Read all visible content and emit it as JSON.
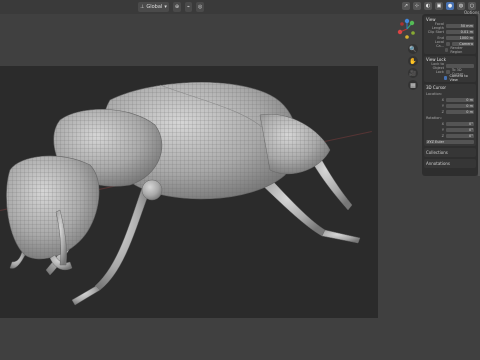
{
  "header": {
    "orientation_label": "Global",
    "options_label": "Options"
  },
  "n_panel": {
    "view_section": "View",
    "focal_label": "Focal Length",
    "focal_value": "50 mm",
    "clip_start_label": "Clip Start",
    "clip_start_value": "0.01 m",
    "clip_end_label": "End",
    "clip_end_value": "1000 m",
    "local_camera_label": "Local Ca...",
    "camera_value": "Camera",
    "render_region_label": "Render Region",
    "view_lock_section": "View Lock",
    "lock_to_object_label": "Lock to Object",
    "lock_label": "Lock",
    "lock_cursor_label": "To 3D Cursor",
    "lock_camera_label": "Camera to View",
    "cursor_section": "3D Cursor",
    "location_label": "Location:",
    "x_label": "X",
    "y_label": "Y",
    "z_label": "Z",
    "loc_x": "0 m",
    "loc_y": "0 m",
    "loc_z": "0 m",
    "rotation_label": "Rotation:",
    "rot_x": "0°",
    "rot_y": "0°",
    "rot_z": "0°",
    "rotation_mode": "XYZ Euler",
    "collections_section": "Collections",
    "annotations_section": "Annotations"
  }
}
